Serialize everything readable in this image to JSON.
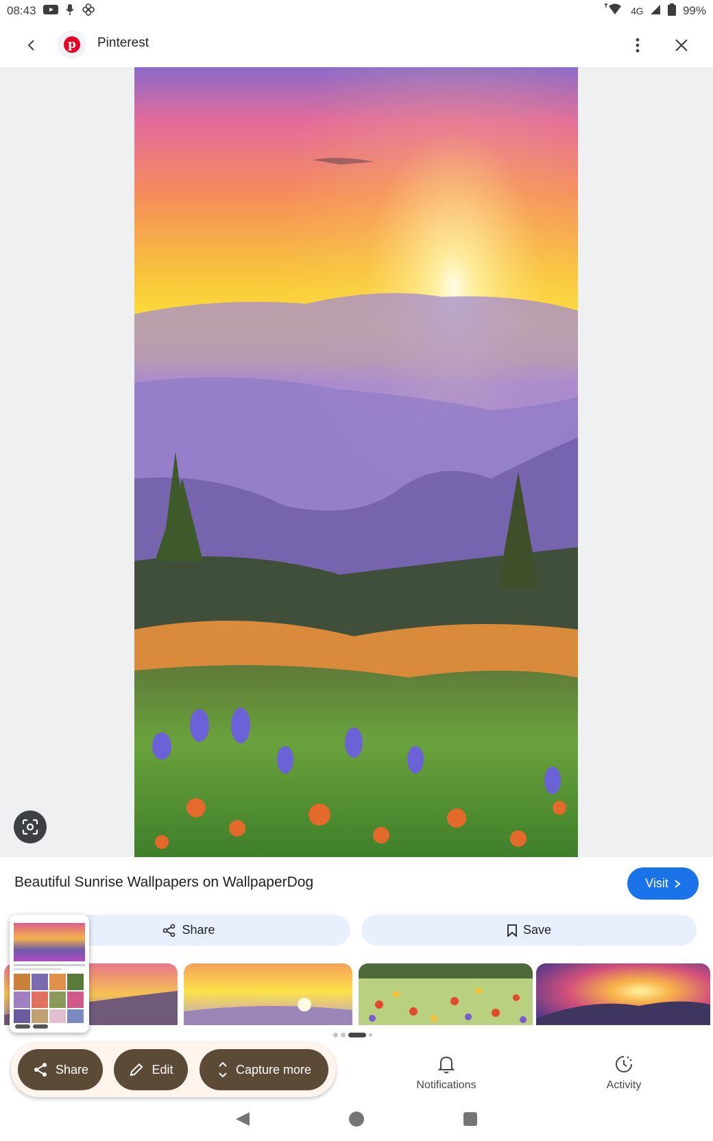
{
  "status_bar": {
    "time": "08:43",
    "network": "4G",
    "battery": "99%"
  },
  "top_bar": {
    "site_name": "Pinterest"
  },
  "result": {
    "title": "Beautiful Sunrise Wallpapers on WallpaperDog",
    "visit_label": "Visit",
    "share_label": "Share",
    "save_label": "Save"
  },
  "carousel": {
    "page_count": 4,
    "active_page": 3
  },
  "screenshot_actions": {
    "share_label": "Share",
    "edit_label": "Edit",
    "capture_more_label": "Capture more"
  },
  "bottom_nav": {
    "notifications_label": "Notifications",
    "activity_label": "Activity"
  },
  "colors": {
    "accent": "#1a73e8",
    "pill_bg": "#e8f0fe",
    "tray_button": "#5b4a36",
    "pinterest_red": "#e60023"
  }
}
